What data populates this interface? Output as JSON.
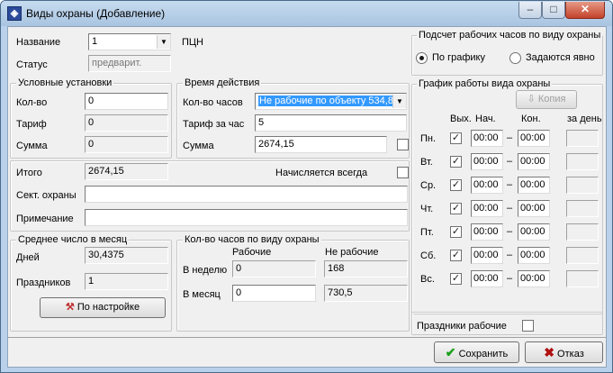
{
  "window": {
    "title": "Виды охраны (Добавление)",
    "icon": "guard-app-icon"
  },
  "header": {
    "name_label": "Название",
    "name_value": "1",
    "name_suffix": "ПЦН",
    "status_label": "Статус",
    "status_value": "предварит."
  },
  "conditions": {
    "legend": "Условные установки",
    "qty_label": "Кол-во",
    "qty_value": "0",
    "tariff_label": "Тариф",
    "tariff_value": "0",
    "sum_label": "Сумма",
    "sum_value": "0"
  },
  "validity": {
    "legend": "Время действия",
    "hours_label": "Кол-во часов",
    "hours_value": "Не рабочие по объекту 534,8",
    "rate_label": "Тариф за час",
    "rate_value": "5",
    "sum_label": "Сумма",
    "sum_value": "2674,15",
    "sum_checked": false
  },
  "totals": {
    "total_label": "Итого",
    "total_value": "2674,15",
    "always_label": "Начисляется всегда",
    "always_checked": false,
    "sect_label": "Сект. охраны",
    "sect_value": "",
    "note_label": "Примечание",
    "note_value": ""
  },
  "monthly_avg": {
    "legend": "Среднее число в месяц",
    "days_label": "Дней",
    "days_value": "30,4375",
    "holidays_label": "Праздников",
    "holidays_value": "1",
    "settings_button": "По настройке"
  },
  "hours_by_type": {
    "legend": "Кол-во часов по виду охраны",
    "col_work": "Рабочие",
    "col_nonwork": "Не рабочие",
    "week_label": "В неделю",
    "week_work": "0",
    "week_nonwork": "168",
    "month_label": "В месяц",
    "month_work": "0",
    "month_nonwork": "730,5"
  },
  "calc": {
    "legend": "Подсчет рабочих часов по виду охраны",
    "option_schedule": "По графику",
    "option_explicit": "Задаются явно",
    "selected": "schedule"
  },
  "schedule": {
    "legend": "График работы вида охраны",
    "copy_button": "Копия",
    "col_off": "Вых.",
    "col_start": "Нач.",
    "col_end": "Кон.",
    "col_perday": "за день",
    "dash": "–",
    "days": [
      {
        "label": "Пн.",
        "off": true,
        "start": "00:00",
        "end": "00:00",
        "perday": ""
      },
      {
        "label": "Вт.",
        "off": true,
        "start": "00:00",
        "end": "00:00",
        "perday": ""
      },
      {
        "label": "Ср.",
        "off": true,
        "start": "00:00",
        "end": "00:00",
        "perday": ""
      },
      {
        "label": "Чт.",
        "off": true,
        "start": "00:00",
        "end": "00:00",
        "perday": ""
      },
      {
        "label": "Пт.",
        "off": true,
        "start": "00:00",
        "end": "00:00",
        "perday": ""
      },
      {
        "label": "Сб.",
        "off": true,
        "start": "00:00",
        "end": "00:00",
        "perday": ""
      },
      {
        "label": "Вс.",
        "off": true,
        "start": "00:00",
        "end": "00:00",
        "perday": ""
      }
    ]
  },
  "holidays_working": {
    "label": "Праздники рабочие",
    "checked": false
  },
  "footer": {
    "save_button": "Сохранить",
    "cancel_button": "Отказ"
  },
  "colors": {
    "accent_blue": "#0000cc",
    "selection": "#3399ff",
    "save_green": "#1aa01a",
    "cancel_red": "#b01010"
  }
}
